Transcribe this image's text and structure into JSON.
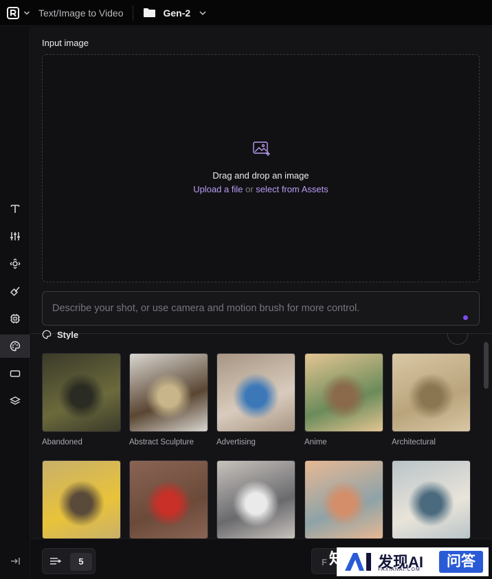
{
  "topbar": {
    "mode_title": "Text/Image to Video",
    "project_name": "Gen-2"
  },
  "sidebar": {
    "items": [
      {
        "icon": "text-icon"
      },
      {
        "icon": "sliders-icon"
      },
      {
        "icon": "camera-motion-icon"
      },
      {
        "icon": "motion-brush-icon"
      },
      {
        "icon": "chip-icon"
      },
      {
        "icon": "palette-icon",
        "active": true
      },
      {
        "icon": "aspect-ratio-icon"
      },
      {
        "icon": "layers-icon"
      },
      {
        "icon": "collapse-sidebar-icon"
      }
    ]
  },
  "input_image": {
    "label": "Input image",
    "drop_title": "Drag and drop an image",
    "upload_link": "Upload a file",
    "or_text": "or",
    "assets_link": "select from Assets"
  },
  "prompt": {
    "placeholder": "Describe your shot, or use camera and motion brush for more control."
  },
  "style": {
    "label": "Style",
    "tiles": [
      {
        "name": "Abandoned",
        "colors": [
          "#3b3a2a",
          "#6b6a3c",
          "#2a2b22"
        ]
      },
      {
        "name": "Abstract Sculpture",
        "colors": [
          "#d9d6d0",
          "#5a4632",
          "#c8b58a"
        ]
      },
      {
        "name": "Advertising",
        "colors": [
          "#a89684",
          "#d8cbbd",
          "#3c78b8"
        ]
      },
      {
        "name": "Anime",
        "colors": [
          "#e3c592",
          "#6b8b5a",
          "#8a6a4a"
        ]
      },
      {
        "name": "Architectural",
        "colors": [
          "#d9c7a4",
          "#b9a47c",
          "#8a7650"
        ]
      },
      {
        "name": "",
        "colors": [
          "#c9b06a",
          "#e8c33a",
          "#5a4a3a"
        ]
      },
      {
        "name": "",
        "colors": [
          "#8a6454",
          "#6b4a3a",
          "#c83028"
        ]
      },
      {
        "name": "",
        "colors": [
          "#c7c2bc",
          "#6a6a6e",
          "#eaeaea"
        ]
      },
      {
        "name": "",
        "colors": [
          "#e7b893",
          "#8ea3a8",
          "#d48f6a"
        ]
      },
      {
        "name": "",
        "colors": [
          "#b9c4c8",
          "#e9e4da",
          "#4a6a7e"
        ]
      }
    ]
  },
  "bottom": {
    "duration_value": "5",
    "generate_label": "F"
  },
  "watermark": {
    "left_char": "知",
    "brand": "发现AI",
    "sub": "FAXIANAI.COM",
    "badge": "问答"
  }
}
